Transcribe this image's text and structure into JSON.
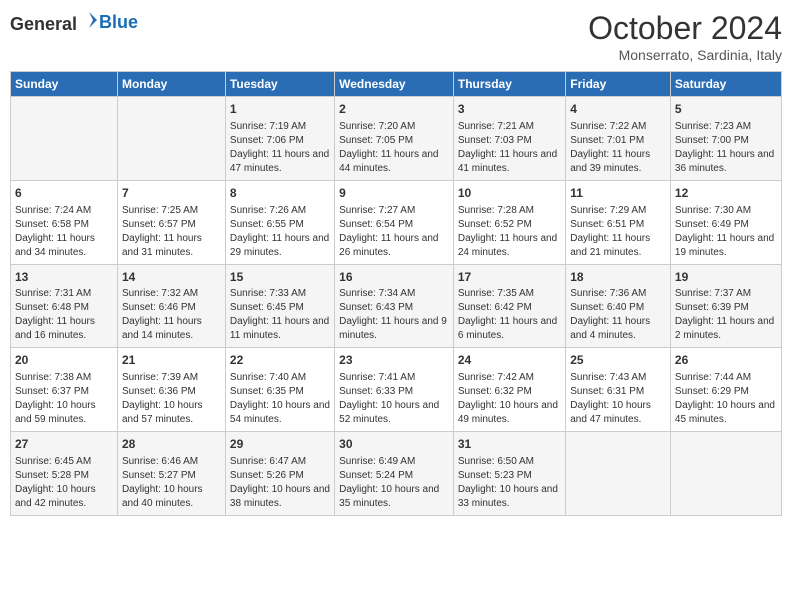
{
  "header": {
    "logo_general": "General",
    "logo_blue": "Blue",
    "month": "October 2024",
    "location": "Monserrato, Sardinia, Italy"
  },
  "days_of_week": [
    "Sunday",
    "Monday",
    "Tuesday",
    "Wednesday",
    "Thursday",
    "Friday",
    "Saturday"
  ],
  "weeks": [
    [
      {
        "day": "",
        "content": ""
      },
      {
        "day": "",
        "content": ""
      },
      {
        "day": "1",
        "content": "Sunrise: 7:19 AM\nSunset: 7:06 PM\nDaylight: 11 hours and 47 minutes."
      },
      {
        "day": "2",
        "content": "Sunrise: 7:20 AM\nSunset: 7:05 PM\nDaylight: 11 hours and 44 minutes."
      },
      {
        "day": "3",
        "content": "Sunrise: 7:21 AM\nSunset: 7:03 PM\nDaylight: 11 hours and 41 minutes."
      },
      {
        "day": "4",
        "content": "Sunrise: 7:22 AM\nSunset: 7:01 PM\nDaylight: 11 hours and 39 minutes."
      },
      {
        "day": "5",
        "content": "Sunrise: 7:23 AM\nSunset: 7:00 PM\nDaylight: 11 hours and 36 minutes."
      }
    ],
    [
      {
        "day": "6",
        "content": "Sunrise: 7:24 AM\nSunset: 6:58 PM\nDaylight: 11 hours and 34 minutes."
      },
      {
        "day": "7",
        "content": "Sunrise: 7:25 AM\nSunset: 6:57 PM\nDaylight: 11 hours and 31 minutes."
      },
      {
        "day": "8",
        "content": "Sunrise: 7:26 AM\nSunset: 6:55 PM\nDaylight: 11 hours and 29 minutes."
      },
      {
        "day": "9",
        "content": "Sunrise: 7:27 AM\nSunset: 6:54 PM\nDaylight: 11 hours and 26 minutes."
      },
      {
        "day": "10",
        "content": "Sunrise: 7:28 AM\nSunset: 6:52 PM\nDaylight: 11 hours and 24 minutes."
      },
      {
        "day": "11",
        "content": "Sunrise: 7:29 AM\nSunset: 6:51 PM\nDaylight: 11 hours and 21 minutes."
      },
      {
        "day": "12",
        "content": "Sunrise: 7:30 AM\nSunset: 6:49 PM\nDaylight: 11 hours and 19 minutes."
      }
    ],
    [
      {
        "day": "13",
        "content": "Sunrise: 7:31 AM\nSunset: 6:48 PM\nDaylight: 11 hours and 16 minutes."
      },
      {
        "day": "14",
        "content": "Sunrise: 7:32 AM\nSunset: 6:46 PM\nDaylight: 11 hours and 14 minutes."
      },
      {
        "day": "15",
        "content": "Sunrise: 7:33 AM\nSunset: 6:45 PM\nDaylight: 11 hours and 11 minutes."
      },
      {
        "day": "16",
        "content": "Sunrise: 7:34 AM\nSunset: 6:43 PM\nDaylight: 11 hours and 9 minutes."
      },
      {
        "day": "17",
        "content": "Sunrise: 7:35 AM\nSunset: 6:42 PM\nDaylight: 11 hours and 6 minutes."
      },
      {
        "day": "18",
        "content": "Sunrise: 7:36 AM\nSunset: 6:40 PM\nDaylight: 11 hours and 4 minutes."
      },
      {
        "day": "19",
        "content": "Sunrise: 7:37 AM\nSunset: 6:39 PM\nDaylight: 11 hours and 2 minutes."
      }
    ],
    [
      {
        "day": "20",
        "content": "Sunrise: 7:38 AM\nSunset: 6:37 PM\nDaylight: 10 hours and 59 minutes."
      },
      {
        "day": "21",
        "content": "Sunrise: 7:39 AM\nSunset: 6:36 PM\nDaylight: 10 hours and 57 minutes."
      },
      {
        "day": "22",
        "content": "Sunrise: 7:40 AM\nSunset: 6:35 PM\nDaylight: 10 hours and 54 minutes."
      },
      {
        "day": "23",
        "content": "Sunrise: 7:41 AM\nSunset: 6:33 PM\nDaylight: 10 hours and 52 minutes."
      },
      {
        "day": "24",
        "content": "Sunrise: 7:42 AM\nSunset: 6:32 PM\nDaylight: 10 hours and 49 minutes."
      },
      {
        "day": "25",
        "content": "Sunrise: 7:43 AM\nSunset: 6:31 PM\nDaylight: 10 hours and 47 minutes."
      },
      {
        "day": "26",
        "content": "Sunrise: 7:44 AM\nSunset: 6:29 PM\nDaylight: 10 hours and 45 minutes."
      }
    ],
    [
      {
        "day": "27",
        "content": "Sunrise: 6:45 AM\nSunset: 5:28 PM\nDaylight: 10 hours and 42 minutes."
      },
      {
        "day": "28",
        "content": "Sunrise: 6:46 AM\nSunset: 5:27 PM\nDaylight: 10 hours and 40 minutes."
      },
      {
        "day": "29",
        "content": "Sunrise: 6:47 AM\nSunset: 5:26 PM\nDaylight: 10 hours and 38 minutes."
      },
      {
        "day": "30",
        "content": "Sunrise: 6:49 AM\nSunset: 5:24 PM\nDaylight: 10 hours and 35 minutes."
      },
      {
        "day": "31",
        "content": "Sunrise: 6:50 AM\nSunset: 5:23 PM\nDaylight: 10 hours and 33 minutes."
      },
      {
        "day": "",
        "content": ""
      },
      {
        "day": "",
        "content": ""
      }
    ]
  ]
}
